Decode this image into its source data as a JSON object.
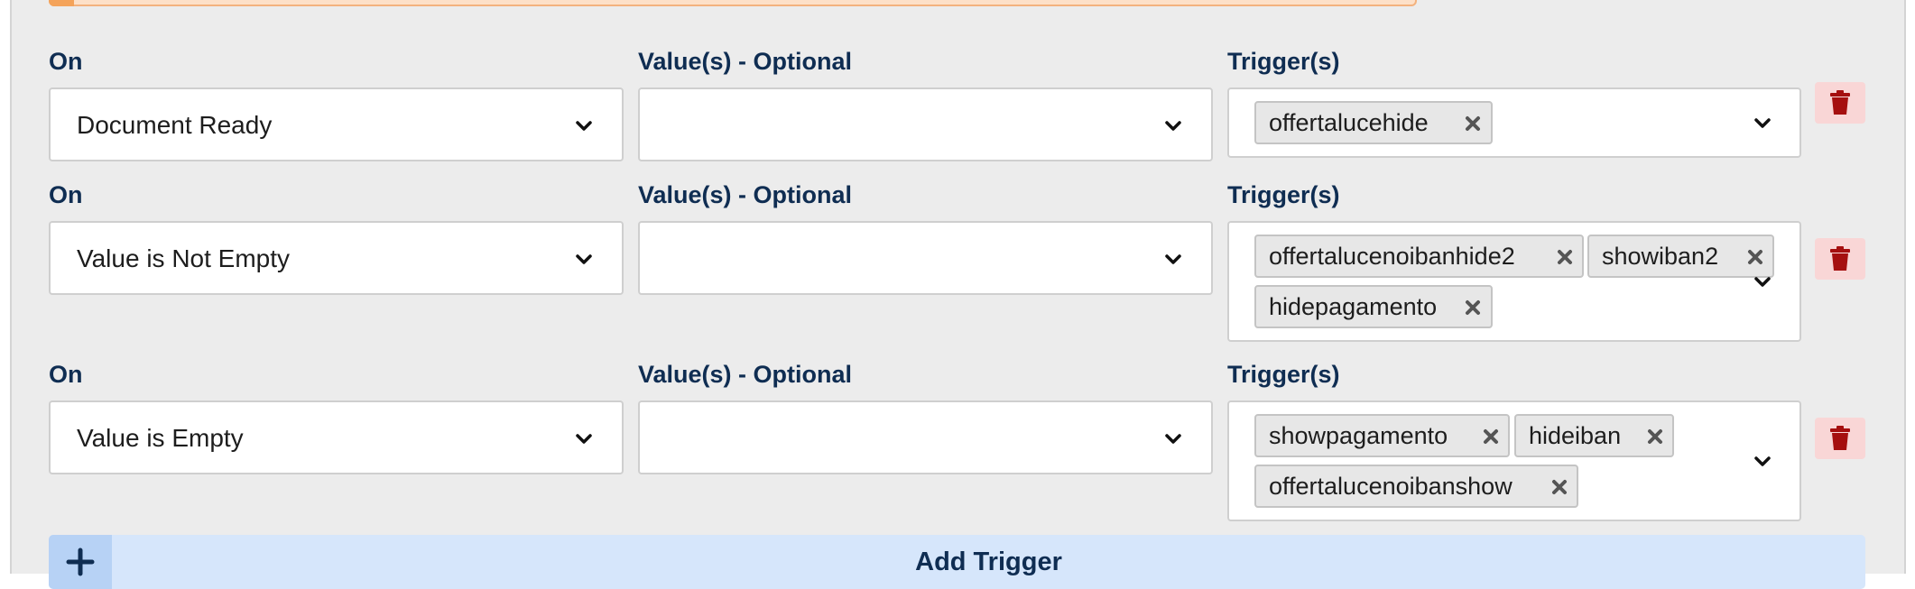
{
  "rows": [
    {
      "on_label": "On",
      "on_value": "Document Ready",
      "values_label": "Value(s) - Optional",
      "values_value": "",
      "triggers_label": "Trigger(s)",
      "triggers": [
        "offertalucehide"
      ]
    },
    {
      "on_label": "On",
      "on_value": "Value is Not Empty",
      "values_label": "Value(s) - Optional",
      "values_value": "",
      "triggers_label": "Trigger(s)",
      "triggers": [
        "offertalucenoibanhide2",
        "showiban2",
        "hidepagamento"
      ]
    },
    {
      "on_label": "On",
      "on_value": "Value is Empty",
      "values_label": "Value(s) - Optional",
      "values_value": "",
      "triggers_label": "Trigger(s)",
      "triggers": [
        "showpagamento",
        "hideiban",
        "offertalucenoibanshow"
      ]
    }
  ],
  "add_button": {
    "label": "Add Trigger",
    "icon": "plus-icon"
  },
  "icons": {
    "chevron": "chevron-down-icon",
    "remove": "close-icon",
    "delete": "trash-icon"
  },
  "colors": {
    "label": "#0f2d52",
    "delete_bg": "#f9d6d6",
    "delete_icon": "#a50f0f",
    "add_bg": "#d6e6fb",
    "warning_border": "#f3b27e"
  }
}
